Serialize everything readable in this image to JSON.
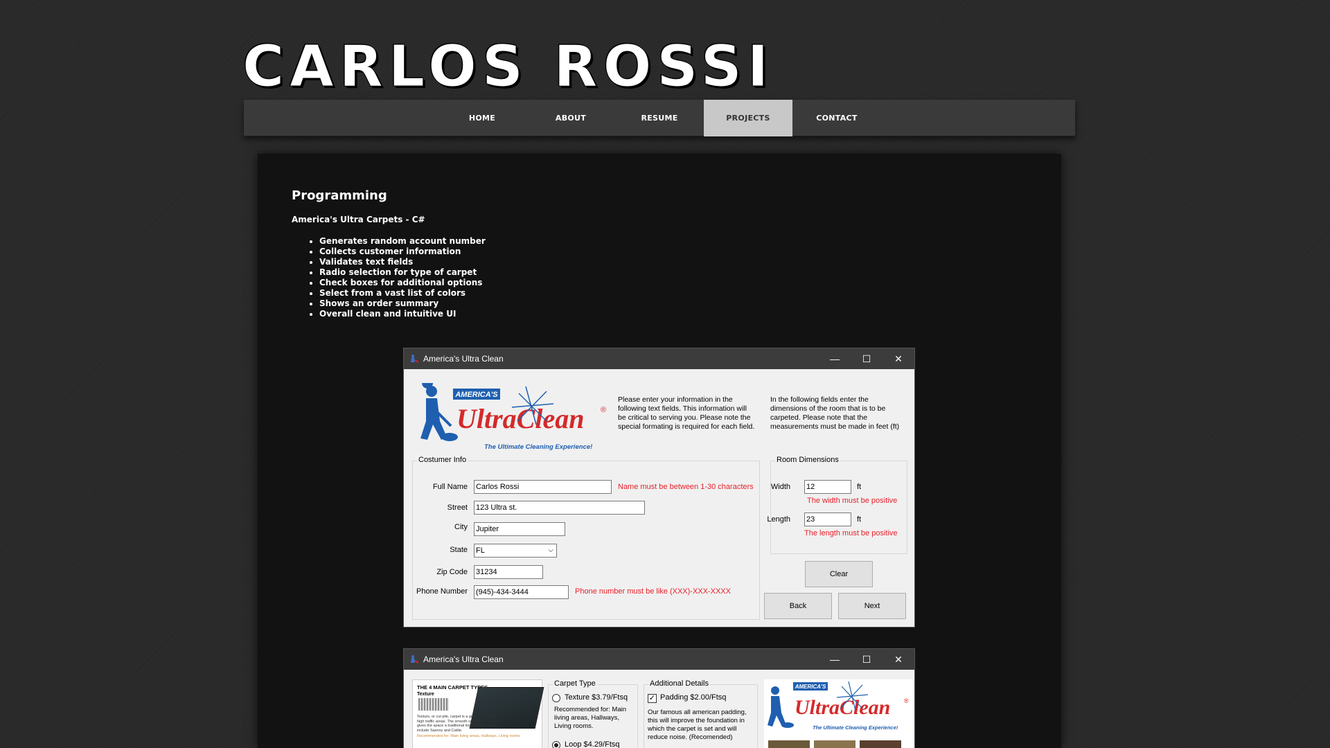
{
  "site": {
    "title": "CARLOS ROSSI"
  },
  "nav": {
    "items": [
      "HOME",
      "ABOUT",
      "RESUME",
      "PROJECTS",
      "CONTACT"
    ],
    "active": "PROJECTS"
  },
  "content": {
    "heading": "Programming",
    "project_title": "America's Ultra Carpets - C#",
    "features": [
      "Generates random account number",
      "Collects customer information",
      "Validates text fields",
      "Radio selection for type of carpet",
      "Check boxes for additional options",
      "Select from a vast list of colors",
      "Shows an order summary",
      "Overall clean and intuitive UI"
    ]
  },
  "window1": {
    "title": "America's Ultra Clean",
    "controls": {
      "minimize": "—",
      "maximize": "☐",
      "close": "✕"
    },
    "logo": {
      "badge": "AMERICA'S",
      "brand": "UltraClean",
      "registered": "®",
      "tagline": "The Ultimate Cleaning Experience!"
    },
    "intro_left": "Please enter your information in the following text fields. This information will be critical to serving you. Please note the special formating is required for each field.",
    "intro_right": "In the following fields enter the dimensions of the room that is to be carpeted. Please note that the measurements must be made in feet (ft)",
    "customer_group": "Costumer Info",
    "fields": {
      "full_name": {
        "label": "Full Name",
        "value": "Carlos Rossi",
        "error": "Name must be between 1-30 characters"
      },
      "street": {
        "label": "Street",
        "value": "123 Ultra st."
      },
      "city": {
        "label": "City",
        "value": "Jupiter"
      },
      "state": {
        "label": "State",
        "value": "FL"
      },
      "zip": {
        "label": "Zip Code",
        "value": "31234"
      },
      "phone": {
        "label": "Phone Number",
        "value": "(945)-434-3444",
        "error": "Phone number must be like (XXX)-XXX-XXXX"
      }
    },
    "room_group": "Room Dimensions",
    "room": {
      "width": {
        "label": "Width",
        "value": "12",
        "unit": "ft",
        "error": "The width must be positive"
      },
      "length": {
        "label": "Length",
        "value": "23",
        "unit": "ft",
        "error": "The length must be positive"
      }
    },
    "buttons": {
      "clear": "Clear",
      "back": "Back",
      "next": "Next"
    }
  },
  "window2": {
    "title": "America's Ultra Clean",
    "controls": {
      "minimize": "—",
      "maximize": "☐",
      "close": "✕"
    },
    "carpet_image": {
      "heading": "THE 4 MAIN CARPET TYPES",
      "subheading": "Texture",
      "caption": "Texture, or cut pile, carpet is a great choice for high traffic areas. The smooth surface of the pile gives the space a traditional look. Similar types include Saxony and Cable.",
      "recommended": "Recommended for: Main living areas, Hallways, Living rooms"
    },
    "carpet_group": "Carpet Type",
    "carpet_options": [
      {
        "label": "Texture $3.79/Ftsq",
        "selected": false
      },
      {
        "label": "Loop $4.29/Ftsq",
        "selected": true
      }
    ],
    "carpet_note": "Recommended for: Main living areas, Hallways, Living rooms.",
    "details_group": "Additional Details",
    "padding_option": {
      "label": "Padding $2.00/Ftsq",
      "checked": true
    },
    "padding_note": "Our famous all american padding, this will improve the foundation in which the carpet is set and will reduce noise. (Recomended)",
    "logo": {
      "badge": "AMERICA'S",
      "brand": "UltraClean",
      "registered": "®",
      "tagline": "The Ultimate Cleaning Experience!"
    }
  }
}
